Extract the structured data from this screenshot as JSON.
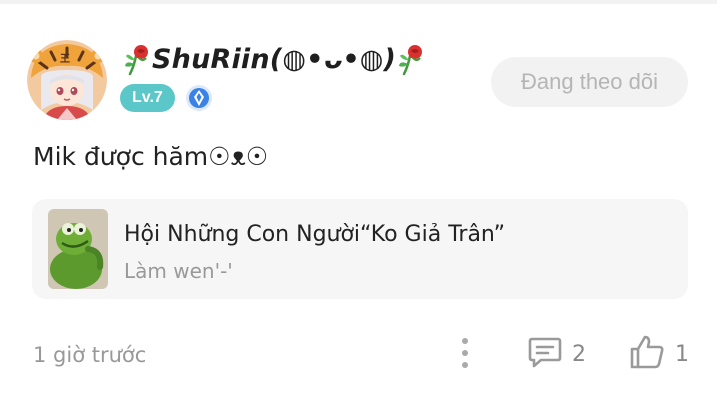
{
  "user": {
    "name": "ShuRiin(◍•ᴗ•◍)",
    "level_badge": "Lv.7",
    "avatar_icon": "tiger-hat-girl-avatar",
    "verify_icon": "blue-verified-badge-icon",
    "name_decoration_icon": "rose-icon"
  },
  "follow_button": {
    "label": "Đang theo dõi"
  },
  "post": {
    "text": "Mik được hăm☉ᴥ☉"
  },
  "group": {
    "name": "Hội Những Con Người“Ko Giả Trân”",
    "description": "Làm wen'-'",
    "thumbnail_icon": "kermit-frog-thumbnail"
  },
  "footer": {
    "timestamp": "1 giờ trước",
    "comment_count": "2",
    "like_count": "1",
    "more_icon": "vertical-dots-icon",
    "comment_icon": "comment-icon",
    "like_icon": "thumbs-up-icon"
  },
  "colors": {
    "level_badge": "#5cc7c9",
    "follow_button_bg": "#f2f2f2",
    "follow_button_text": "#b5b5b5",
    "card_bg": "#f6f6f6",
    "muted_text": "#999999",
    "verify_blue": "#3b82e6"
  }
}
